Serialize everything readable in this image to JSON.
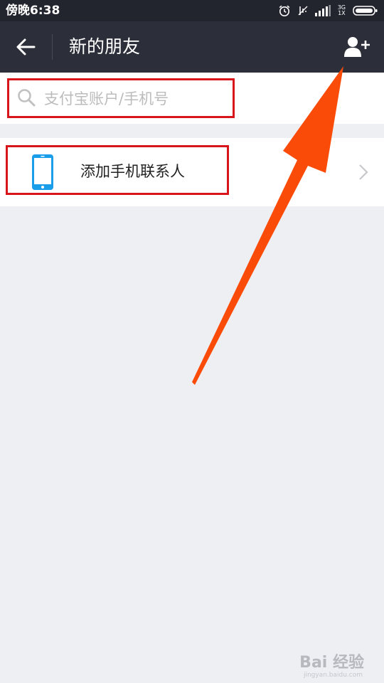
{
  "status_bar": {
    "time": "傍晚6:38",
    "network_top": "3G",
    "network_bottom": "1X",
    "icons": [
      "alarm-icon",
      "mute-icon",
      "signal-icon",
      "battery-icon"
    ]
  },
  "header": {
    "title": "新的朋友",
    "back_icon": "arrow-left-icon",
    "action_icon": "add-person-icon"
  },
  "search": {
    "placeholder": "支付宝账户/手机号",
    "value": ""
  },
  "contacts_entry": {
    "label": "添加手机联系人",
    "icon": "phone-icon"
  },
  "watermark": {
    "text": "Bai 经验",
    "sub": "jingyan.baidu.com"
  },
  "colors": {
    "header_bg": "#2c2f39",
    "status_bg": "#22252e",
    "page_bg": "#eeeff3",
    "highlight": "#d8151b",
    "arrow": "#fb4b08",
    "phone_icon": "#1a9eea"
  }
}
